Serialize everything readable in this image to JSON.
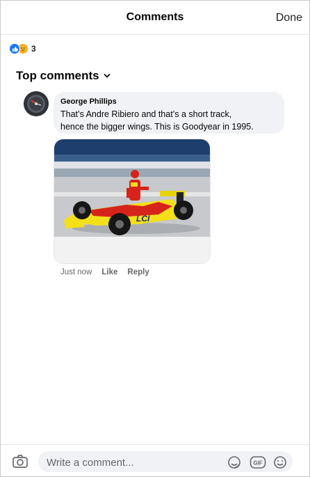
{
  "header": {
    "title": "Comments",
    "done_label": "Done"
  },
  "reactions": {
    "icons": [
      "like-icon",
      "sad-icon"
    ],
    "count": "3",
    "colors": {
      "like": "#1877f2",
      "sad": "#f7b125"
    }
  },
  "section": {
    "title": "Top comments",
    "icon": "chevron-down-icon"
  },
  "comment": {
    "author": "George Phillips",
    "text_line1": "That’s Andre Ribiero and that’s a short track,",
    "text_line2": "hence the bigger wings. This is Goodyear in 1995.",
    "photo_sponsor": "LCI",
    "timestamp": "Just now",
    "like_label": "Like",
    "reply_label": "Reply"
  },
  "composer": {
    "placeholder": "Write a comment...",
    "icons": [
      "camera-icon",
      "sticker-icon",
      "gif-icon",
      "emoji-icon"
    ],
    "gif_label": "GIF"
  }
}
